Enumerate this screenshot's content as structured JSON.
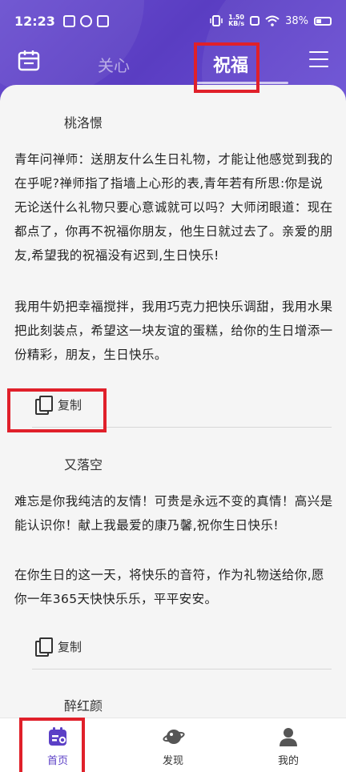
{
  "status_bar": {
    "time": "12:23",
    "net_speed_top": "1.50",
    "net_speed_bottom": "KB/s",
    "battery": "38%"
  },
  "nav": {
    "tabs": [
      {
        "label": "关心",
        "selected": false
      },
      {
        "label": "祝福",
        "selected": true
      }
    ],
    "calendar_icon": "calendar-icon",
    "menu_icon": "hamburger-menu-icon"
  },
  "entries": [
    {
      "author": "桃洛憬",
      "paragraphs": [
        "青年问禅师：送朋友什么生日礼物，才能让他感觉到我的在乎呢?禅师指了指墙上心形的表,青年若有所思:你是说无论送什么礼物只要心意诚就可以吗？大师闭眼道：现在都点了，你再不祝福你朋友，他生日就过去了。亲爱的朋友,希望我的祝福没有迟到,生日快乐!",
        "我用牛奶把幸福搅拌，我用巧克力把快乐调甜，我用水果把此刻装点，希望这一块友谊的蛋糕，给你的生日增添一份精彩，朋友，生日快乐。"
      ],
      "copy_label": "复制"
    },
    {
      "author": "又落空",
      "paragraphs": [
        "难忘是你我纯洁的友情！可贵是永远不变的真情！高兴是能认识你！献上我最爱的康乃馨,祝你生日快乐!",
        "在你生日的这一天，将快乐的音符，作为礼物送给你,愿你一年365天快快乐乐，平平安安。"
      ],
      "copy_label": "复制"
    },
    {
      "author": "醉红颜"
    }
  ],
  "bottom_nav": [
    {
      "label": "首页",
      "icon": "home-calendar-icon",
      "active": true
    },
    {
      "label": "发现",
      "icon": "planet-icon",
      "active": false
    },
    {
      "label": "我的",
      "icon": "person-icon",
      "active": false
    }
  ],
  "colors": {
    "accent": "#5b3fc6",
    "highlight": "#e0202a"
  }
}
